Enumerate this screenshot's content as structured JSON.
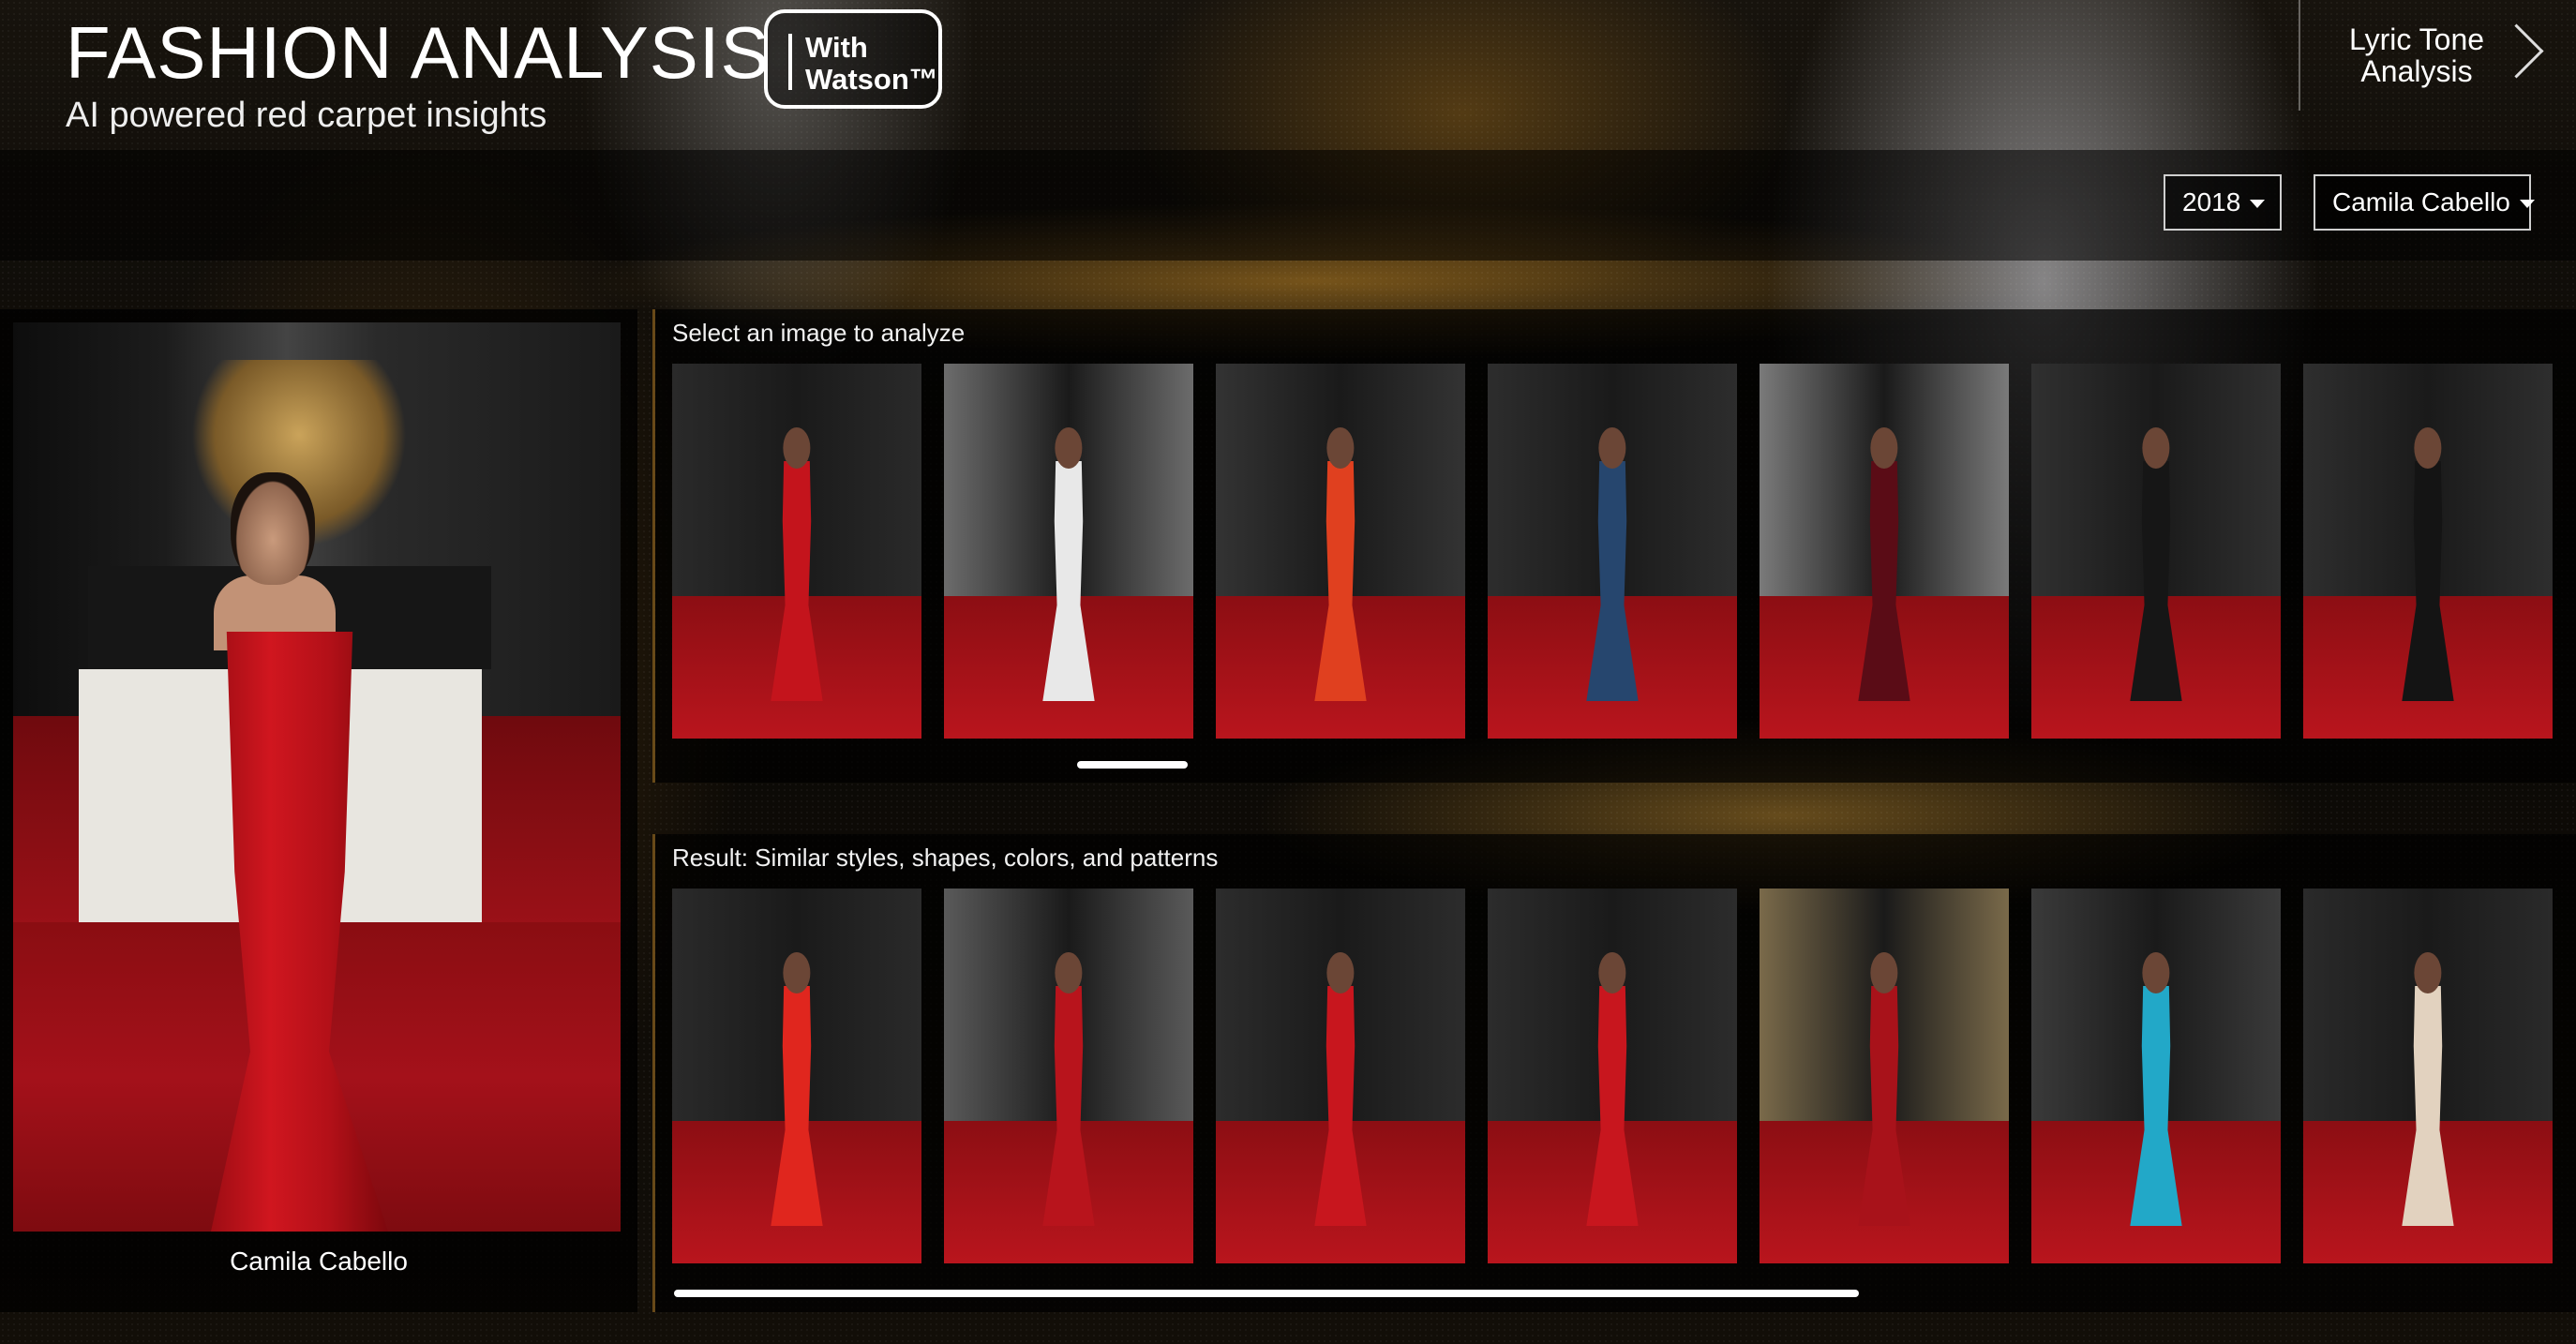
{
  "header": {
    "title": "FASHION ANALYSIS",
    "subtitle": "AI powered red carpet insights",
    "badge_line1": "With",
    "badge_line2": "Watson™",
    "nav_link_line1": "Lyric Tone",
    "nav_link_line2": "Analysis",
    "nav_icon": "chevron-right-icon"
  },
  "controls": {
    "year_selected": "2018",
    "artist_selected": "Camila Cabello"
  },
  "feature": {
    "caption": "Camila Cabello",
    "dress_color": "#c8141c"
  },
  "select_gallery": {
    "label": "Select an image to analyze",
    "thumbnails": [
      {
        "wall": "#2a2a2a",
        "outfit": "#c4141c",
        "selected": true
      },
      {
        "wall": "#6c6c6c",
        "outfit": "#e8e8e8"
      },
      {
        "wall": "#333333",
        "outfit": "#e0401f"
      },
      {
        "wall": "#2d2d2d",
        "outfit": "#26466e"
      },
      {
        "wall": "#7a7a7a",
        "outfit": "#5a0c16"
      },
      {
        "wall": "#303030",
        "outfit": "#161616"
      },
      {
        "wall": "#2e2e2e",
        "outfit": "#141414"
      }
    ]
  },
  "result_gallery": {
    "label": "Result: Similar styles, shapes, colors, and patterns",
    "thumbnails": [
      {
        "wall": "#2a2a2a",
        "outfit": "#e0261e"
      },
      {
        "wall": "#5a5a5a",
        "outfit": "#b8141c"
      },
      {
        "wall": "#2c2c2c",
        "outfit": "#c8161e"
      },
      {
        "wall": "#2c2c2c",
        "outfit": "#c8161e"
      },
      {
        "wall": "#7a6a4a",
        "outfit": "#a8121a"
      },
      {
        "wall": "#3a3a3a",
        "outfit": "#22a8c8"
      },
      {
        "wall": "#2a2a2a",
        "outfit": "#e2d2bf"
      }
    ]
  },
  "colors": {
    "accent_gold": "#b8862e",
    "carpet_red": "#a4111a"
  }
}
